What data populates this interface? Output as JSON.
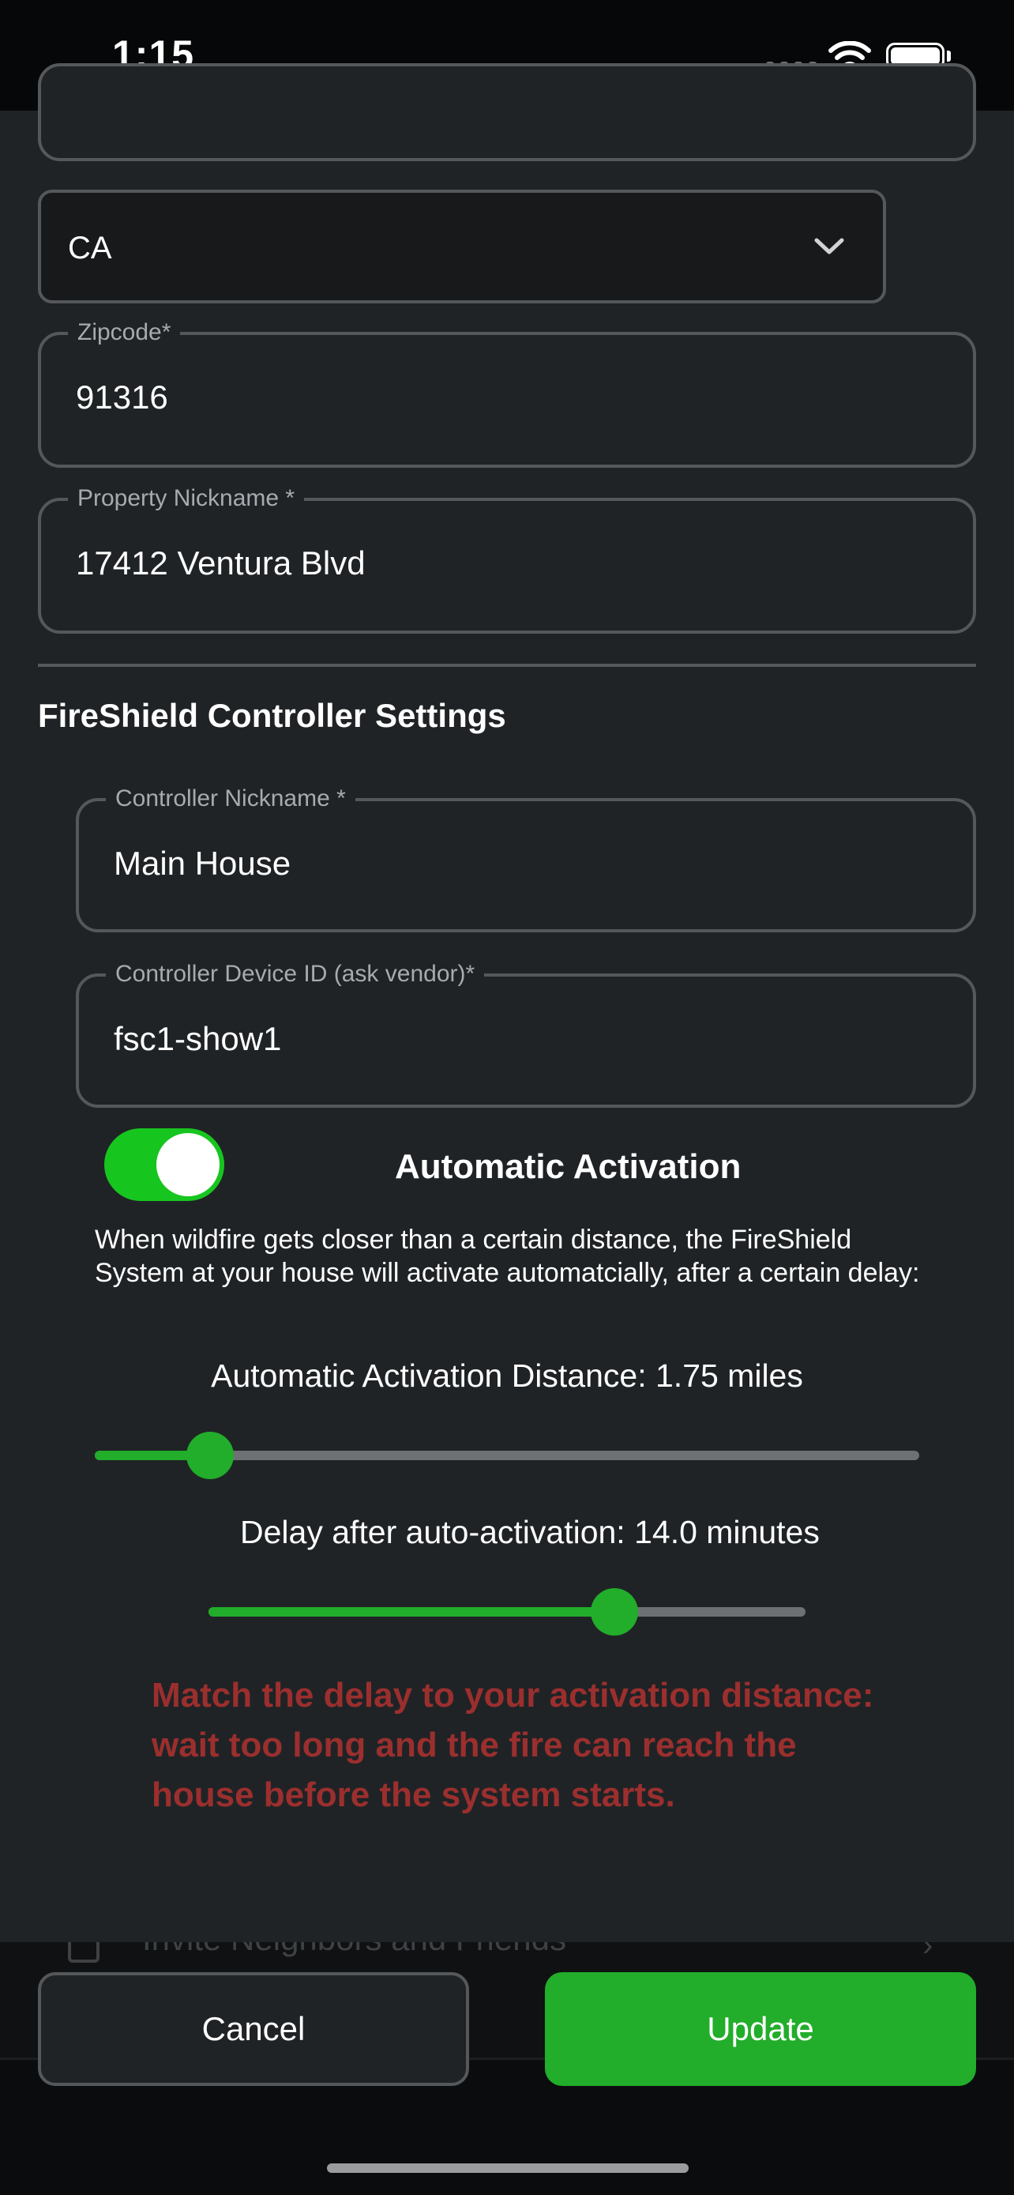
{
  "status_bar": {
    "time": "1:15"
  },
  "form": {
    "state": {
      "value": "CA"
    },
    "zipcode": {
      "label": "Zipcode*",
      "value": "91316"
    },
    "property_nickname": {
      "label": "Property Nickname *",
      "value": "17412 Ventura Blvd"
    }
  },
  "controller": {
    "section_title": "FireShield Controller Settings",
    "nickname": {
      "label": "Controller Nickname *",
      "value": "Main House"
    },
    "device_id": {
      "label": "Controller Device ID (ask vendor)*",
      "value": "fsc1-show1"
    },
    "automatic_activation": {
      "label": "Automatic Activation",
      "enabled": true,
      "description": "When wildfire gets closer than a certain distance, the FireShield System at your house will activate automatcially, after a certain delay:"
    },
    "distance": {
      "label": "Automatic Activation Distance: 1.75 miles",
      "fraction": 0.14
    },
    "delay": {
      "label": "Delay after auto-activation: 14.0 minutes",
      "fraction": 0.68
    },
    "warning": "Match the delay to your activation distance: wait too long and the fire can reach the house before the system starts."
  },
  "background_list": {
    "item_label": "Invite Neighbors and Friends"
  },
  "buttons": {
    "cancel": "Cancel",
    "update": "Update"
  },
  "colors": {
    "accent": "#22ad2a",
    "toggle_on": "#17c51f",
    "warning": "#9b2f2e",
    "sheet": "#1f2326"
  }
}
